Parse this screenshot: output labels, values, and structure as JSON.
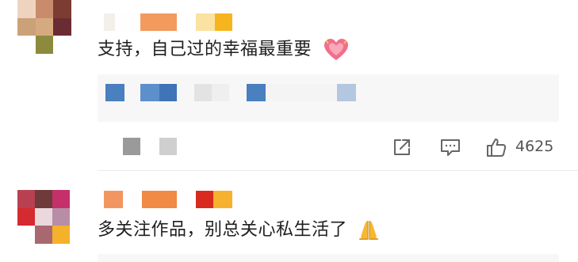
{
  "comments": [
    {
      "text": "支持，自己过的幸福最重要",
      "emoji_icon": "growing-heart-icon",
      "actions": {
        "share_icon": "share-icon",
        "comment_icon": "comment-icon",
        "like_icon": "thumbs-up-icon",
        "like_count": "4625"
      }
    },
    {
      "text": "多关注作品，别总关心私生活了",
      "emoji_icon": "folded-hands-icon"
    }
  ],
  "colors": {
    "accent_blue": "#4a7fc0",
    "icon_gray": "#666666",
    "card_bg": "#f7f7f7"
  }
}
